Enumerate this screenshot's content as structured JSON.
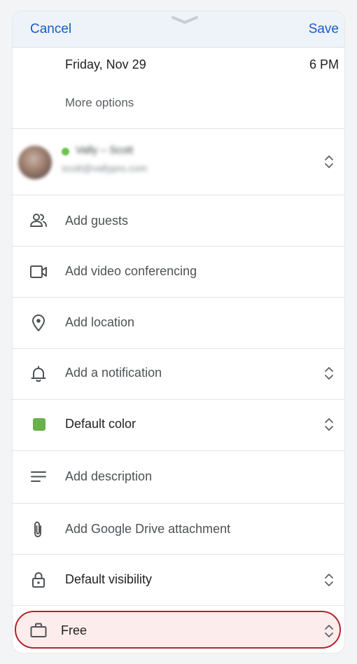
{
  "header": {
    "cancel_label": "Cancel",
    "save_label": "Save"
  },
  "event": {
    "date": "Friday, Nov 29",
    "time": "6 PM",
    "more_options": "More options"
  },
  "account": {
    "name": "Vally – Scott",
    "email": "scott@vallypro.com"
  },
  "rows": {
    "guests": "Add guests",
    "video": "Add video conferencing",
    "location": "Add location",
    "notification": "Add a notification",
    "color": "Default color",
    "description": "Add description",
    "drive": "Add Google Drive attachment",
    "visibility": "Default visibility",
    "availability": "Free"
  },
  "colors": {
    "accent": "#1a5ac7",
    "event_color": "#6ab04c",
    "highlight_border": "#b3242f",
    "highlight_fill": "#fcecec"
  },
  "icons": [
    "people-icon",
    "video-icon",
    "location-pin-icon",
    "bell-icon",
    "color-swatch-icon",
    "description-lines-icon",
    "paperclip-icon",
    "lock-icon",
    "briefcase-icon",
    "chevron-updown-icon"
  ]
}
